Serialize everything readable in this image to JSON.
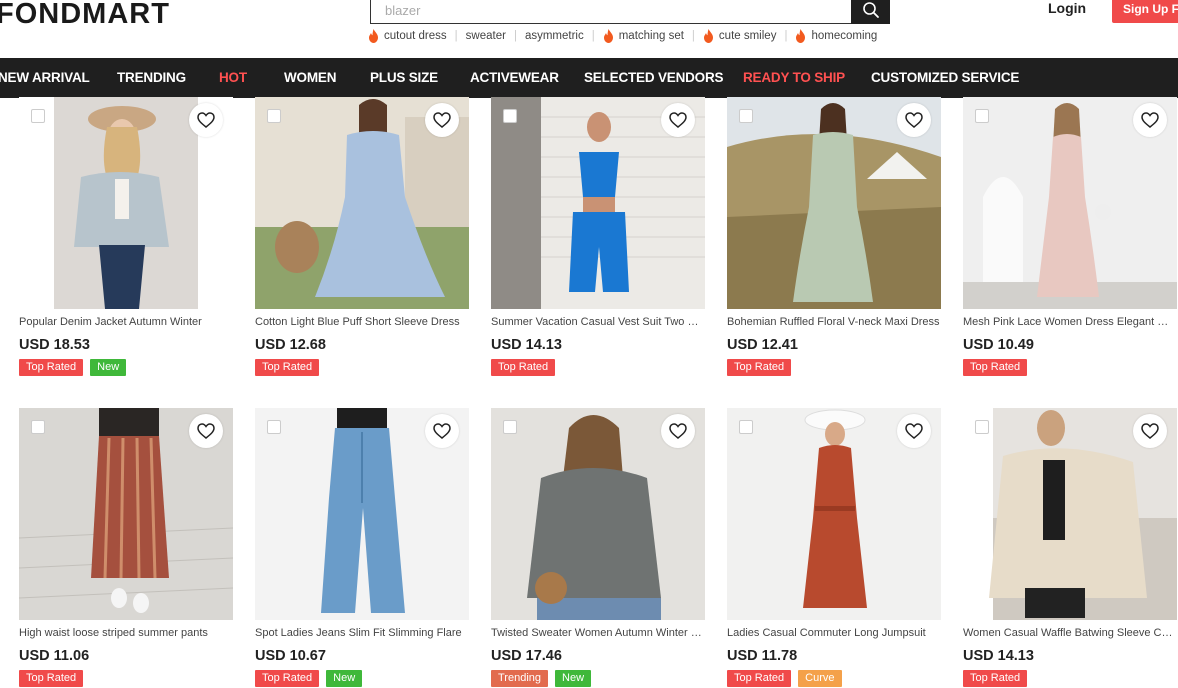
{
  "brand": {
    "logo": "FONDMART"
  },
  "search": {
    "placeholder": "blazer"
  },
  "hot_tags": [
    "cutout dress",
    "sweater",
    "asymmetric",
    "matching set",
    "cute smiley",
    "homecoming"
  ],
  "header": {
    "login": "Login",
    "signup": "Sign Up Free"
  },
  "nav": [
    "NEW ARRIVAL",
    "TRENDING",
    "HOT",
    "WOMEN",
    "PLUS SIZE",
    "ACTIVEWEAR",
    "SELECTED VENDORS",
    "READY TO SHIP",
    "CUSTOMIZED SERVICE"
  ],
  "products": [
    {
      "title": "Popular Denim Jacket Autumn Winter",
      "price": "USD 18.53",
      "badges": [
        "Top Rated",
        "New"
      ]
    },
    {
      "title": "Cotton Light Blue Puff Short Sleeve Dress",
      "price": "USD 12.68",
      "badges": [
        "Top Rated"
      ]
    },
    {
      "title": "Summer Vacation Casual Vest Suit Two Piece",
      "price": "USD 14.13",
      "badges": [
        "Top Rated"
      ]
    },
    {
      "title": "Bohemian Ruffled Floral V-neck Maxi Dress",
      "price": "USD 12.41",
      "badges": [
        "Top Rated"
      ]
    },
    {
      "title": "Mesh Pink Lace Women Dress Elegant Maxi",
      "price": "USD 10.49",
      "badges": [
        "Top Rated"
      ]
    },
    {
      "title": "High waist loose striped summer pants",
      "price": "USD 11.06",
      "badges": [
        "Top Rated"
      ]
    },
    {
      "title": "Spot Ladies Jeans Slim Fit Slimming Flare",
      "price": "USD 10.67",
      "badges": [
        "Top Rated",
        "New"
      ]
    },
    {
      "title": "Twisted Sweater Women Autumn Winter Knit",
      "price": "USD 17.46",
      "badges": [
        "Trending",
        "New"
      ]
    },
    {
      "title": "Ladies Casual Commuter Long Jumpsuit",
      "price": "USD 11.78",
      "badges": [
        "Top Rated",
        "Curve"
      ]
    },
    {
      "title": "Women Casual Waffle Batwing Sleeve Cardigan",
      "price": "USD 14.13",
      "badges": [
        "Top Rated"
      ]
    }
  ],
  "badge_colors": {
    "Top Rated": "#f04a4a",
    "New": "#3fb83a",
    "Trending": "#e26b4e",
    "Curve": "#f4a14a"
  },
  "colors": {
    "accent": "#f04a4a",
    "nav_bg": "#1f1f1f",
    "nav_highlight": "#ff5151"
  }
}
